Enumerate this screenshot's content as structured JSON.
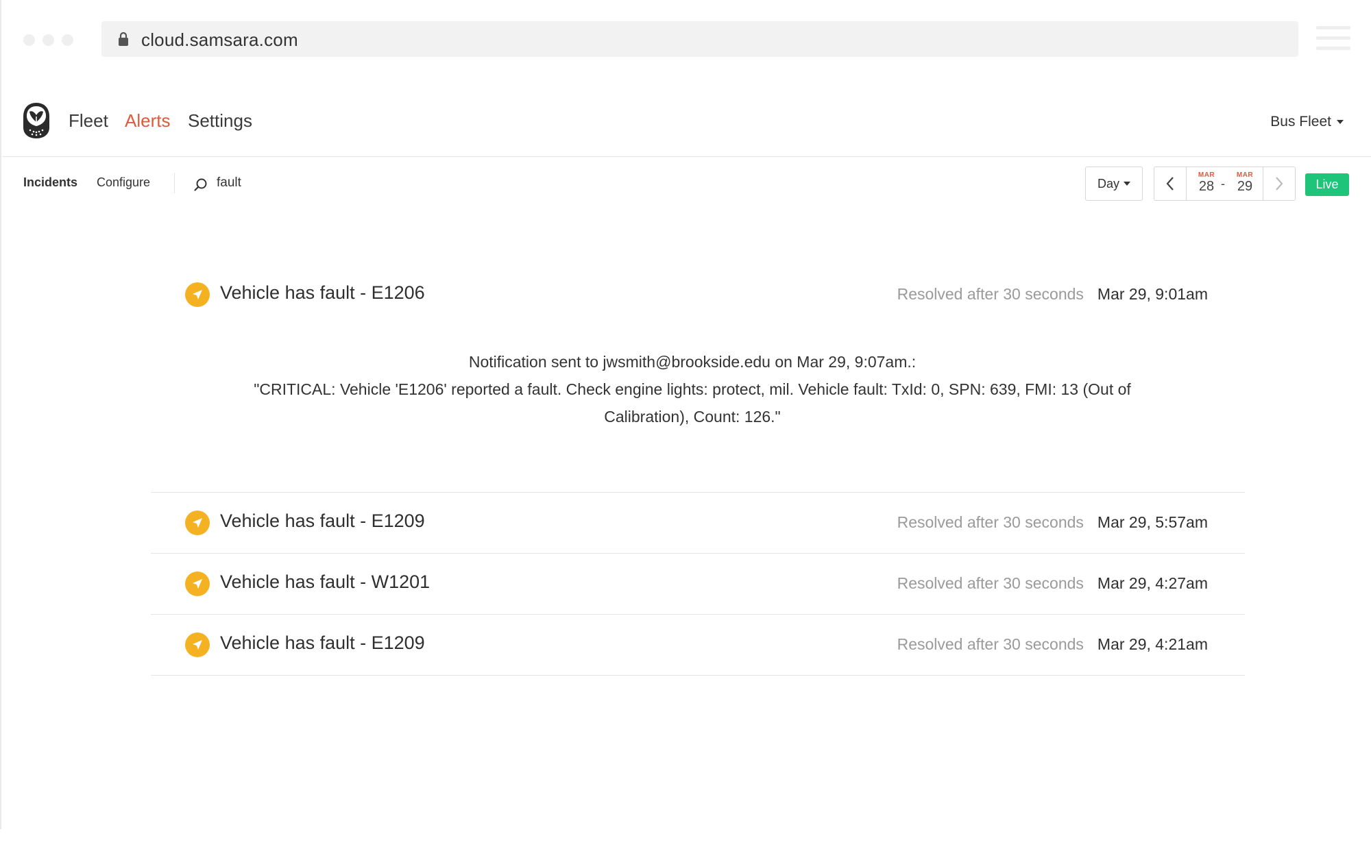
{
  "browser": {
    "url": "cloud.samsara.com"
  },
  "nav": {
    "items": [
      {
        "label": "Fleet",
        "active": false
      },
      {
        "label": "Alerts",
        "active": true
      },
      {
        "label": "Settings",
        "active": false
      }
    ],
    "fleet_selector": "Bus Fleet"
  },
  "toolbar": {
    "tabs": [
      {
        "label": "Incidents",
        "active": true
      },
      {
        "label": "Configure",
        "active": false
      }
    ],
    "search": {
      "value": "fault"
    },
    "period": "Day",
    "date_range": {
      "start": {
        "month": "MAR",
        "day": "28"
      },
      "separator": "-",
      "end": {
        "month": "MAR",
        "day": "29"
      }
    },
    "live_label": "Live"
  },
  "incidents": [
    {
      "title": "Vehicle has fault - E1206",
      "status": "Resolved after 30 seconds",
      "time": "Mar 29, 9:01am",
      "expanded": true,
      "notification": {
        "header": "Notification sent to jwsmith@brookside.edu on Mar 29, 9:07am.:",
        "message": "\"CRITICAL: Vehicle 'E1206' reported a fault. Check engine lights: protect, mil. Vehicle fault: TxId: 0, SPN: 639, FMI: 13 (Out of Calibration), Count: 126.\""
      }
    },
    {
      "title": "Vehicle has fault - E1209",
      "status": "Resolved after 30 seconds",
      "time": "Mar 29, 5:57am",
      "expanded": false
    },
    {
      "title": "Vehicle has fault - W1201",
      "status": "Resolved after 30 seconds",
      "time": "Mar 29, 4:27am",
      "expanded": false
    },
    {
      "title": "Vehicle has fault - E1209",
      "status": "Resolved after 30 seconds",
      "time": "Mar 29, 4:21am",
      "expanded": false
    }
  ],
  "colors": {
    "accent": "#e0593b",
    "live": "#1ec47a",
    "alert": "#f4b223"
  }
}
